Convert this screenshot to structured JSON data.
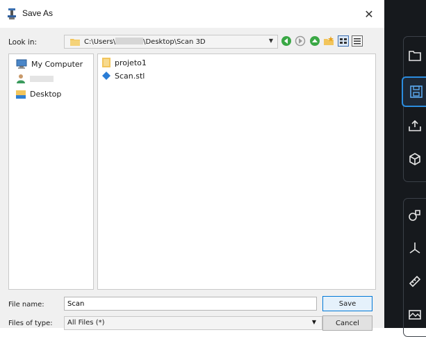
{
  "dialog": {
    "title": "Save As",
    "close_glyph": "✕",
    "look_in_label": "Look in:",
    "path_prefix": "C:\\Users\\",
    "path_suffix": "\\Desktop\\Scan 3D",
    "combo_arrow": "▼",
    "nav_icons": [
      "back-icon",
      "forward-icon",
      "up-icon",
      "new-folder-icon",
      "list-view-icon",
      "detail-view-icon"
    ],
    "places": [
      {
        "label": "My Computer",
        "icon": "computer-icon"
      },
      {
        "label": "",
        "icon": "user-folder-icon"
      },
      {
        "label": "Desktop",
        "icon": "desktop-folder-icon"
      }
    ],
    "files": [
      {
        "label": "projeto1",
        "icon": "folder-icon"
      },
      {
        "label": "Scan.stl",
        "icon": "stl-file-icon"
      }
    ],
    "file_name_label": "File name:",
    "file_name_value": "Scan",
    "files_of_type_label": "Files of type:",
    "files_of_type_value": "All Files (*)",
    "save_label": "Save",
    "cancel_label": "Cancel"
  },
  "app_panel": {
    "background": "#16191d",
    "accent": "#2b8de0",
    "tools": [
      "open-folder-icon",
      "save-icon",
      "export-icon",
      "3d-box-icon",
      "shapes-icon",
      "axis-icon",
      "measure-icon",
      "image-icon"
    ]
  }
}
